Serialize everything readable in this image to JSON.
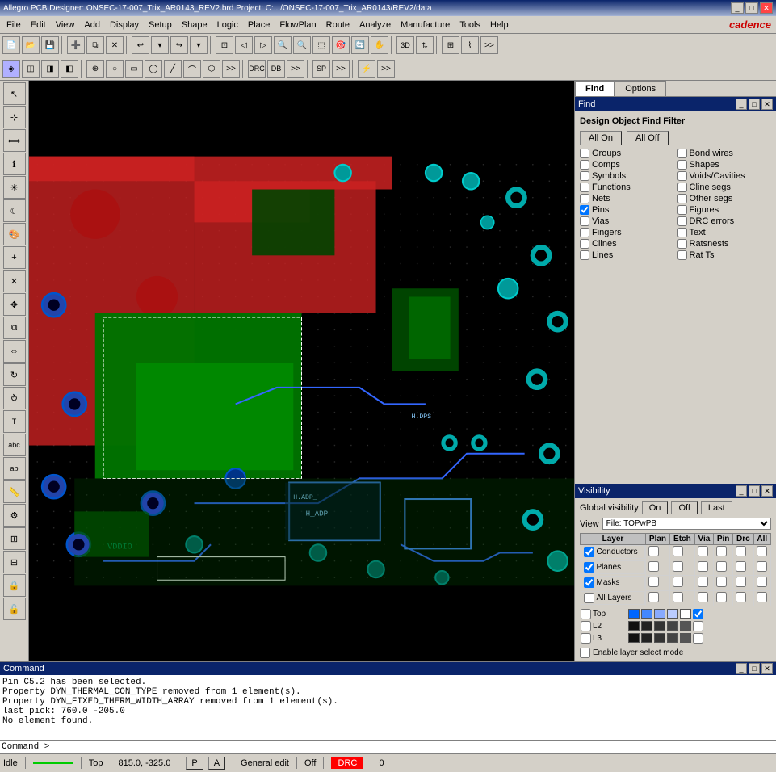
{
  "titleBar": {
    "title": "Allegro PCB Designer: ONSEC-17-007_Trix_AR0143_REV2.brd  Project: C:.../ONSEC-17-007_Trix_AR0143/REV2/data",
    "controls": [
      "_",
      "□",
      "✕"
    ]
  },
  "menuBar": {
    "items": [
      "File",
      "Edit",
      "View",
      "Add",
      "Display",
      "Setup",
      "Shape",
      "Logic",
      "Place",
      "FlowPlan",
      "Route",
      "Analyze",
      "Manufacture",
      "Tools",
      "Help"
    ],
    "logo": "cadence"
  },
  "findPanel": {
    "title": "Find",
    "filterTitle": "Design Object Find Filter",
    "allOnLabel": "All On",
    "allOffLabel": "All Off",
    "checkboxes": [
      {
        "id": "groups",
        "label": "Groups",
        "checked": false,
        "col": 1
      },
      {
        "id": "bondwires",
        "label": "Bond wires",
        "checked": false,
        "col": 2
      },
      {
        "id": "comps",
        "label": "Comps",
        "checked": false,
        "col": 1
      },
      {
        "id": "shapes",
        "label": "Shapes",
        "checked": false,
        "col": 2
      },
      {
        "id": "symbols",
        "label": "Symbols",
        "checked": false,
        "col": 1
      },
      {
        "id": "voidcavities",
        "label": "Voids/Cavities",
        "checked": false,
        "col": 2
      },
      {
        "id": "functions",
        "label": "Functions",
        "checked": false,
        "col": 1
      },
      {
        "id": "clinesegs",
        "label": "Cline segs",
        "checked": false,
        "col": 2
      },
      {
        "id": "nets",
        "label": "Nets",
        "checked": false,
        "col": 1
      },
      {
        "id": "othersegs",
        "label": "Other segs",
        "checked": false,
        "col": 2
      },
      {
        "id": "pins",
        "label": "Pins",
        "checked": true,
        "col": 1
      },
      {
        "id": "figures",
        "label": "Figures",
        "checked": false,
        "col": 2
      },
      {
        "id": "vias",
        "label": "Vias",
        "checked": false,
        "col": 1
      },
      {
        "id": "drcerrors",
        "label": "DRC errors",
        "checked": false,
        "col": 2
      },
      {
        "id": "fingers",
        "label": "Fingers",
        "checked": false,
        "col": 1
      },
      {
        "id": "text",
        "label": "Text",
        "checked": false,
        "col": 2
      },
      {
        "id": "clines",
        "label": "Clines",
        "checked": false,
        "col": 1
      },
      {
        "id": "ratsnests",
        "label": "Ratsnests",
        "checked": false,
        "col": 2
      },
      {
        "id": "lines",
        "label": "Lines",
        "checked": false,
        "col": 1
      },
      {
        "id": "ratTs",
        "label": "Rat Ts",
        "checked": false,
        "col": 2
      }
    ]
  },
  "optionsPanel": {
    "title": "Options"
  },
  "visibilityPanel": {
    "title": "Visibility",
    "globalVisLabel": "Global visibility",
    "onLabel": "On",
    "offLabel": "Off",
    "lastLabel": "Last",
    "viewLabel": "View",
    "viewValue": "File: TOPwPB",
    "columns": [
      "Layer",
      "Plan",
      "Etch",
      "Via",
      "Pin",
      "Drc",
      "All"
    ],
    "layers": [
      {
        "name": "Conductors",
        "checked": true,
        "color": "#00aaff",
        "plan": false,
        "etch": false,
        "via": false,
        "pin": false,
        "drc": false,
        "all": false
      },
      {
        "name": "Planes",
        "checked": true,
        "color": "#008800",
        "plan": false,
        "etch": false,
        "via": false,
        "pin": false,
        "drc": false,
        "all": false
      },
      {
        "name": "Masks",
        "checked": true,
        "color": "#880088",
        "plan": false,
        "etch": false,
        "via": false,
        "pin": false,
        "drc": false,
        "all": false
      },
      {
        "name": "All Layers",
        "checked": false,
        "color": "#888888",
        "plan": false,
        "etch": false,
        "via": false,
        "pin": false,
        "drc": false,
        "all": false
      }
    ],
    "specificLayers": [
      {
        "name": "Top",
        "checked": false,
        "color": "#0066ff",
        "swatches": [
          "#0066ff",
          "#4488ff",
          "#88aaff",
          "#bbccff",
          "#ffffff"
        ]
      },
      {
        "name": "L2",
        "checked": false,
        "color": "#111111",
        "swatches": [
          "#111111",
          "#222222",
          "#333333",
          "#444444",
          "#555555"
        ]
      },
      {
        "name": "L3",
        "checked": false,
        "color": "#111111",
        "swatches": [
          "#111111",
          "#222222",
          "#333333",
          "#444444",
          "#555555"
        ]
      }
    ],
    "enableLayerSelect": "Enable layer select mode"
  },
  "commandPanel": {
    "title": "Command",
    "lines": [
      "Pin C5.2  has been selected.",
      "Property DYN_THERMAL_CON_TYPE removed from 1 element(s).",
      "Property DYN_FIXED_THERM_WIDTH_ARRAY removed from 1 element(s).",
      "last pick:  760.0 -205.0",
      "No element found.",
      "Command >"
    ],
    "prompt": "Command >"
  },
  "statusBar": {
    "idle": "Idle",
    "greenIndicator": "",
    "layer": "Top",
    "coordinates": "815.0, -325.0",
    "padlock": "P",
    "lock": "A",
    "generalEdit": "General edit",
    "toggle": "Off",
    "drc": "DRC",
    "drcValue": "0"
  }
}
